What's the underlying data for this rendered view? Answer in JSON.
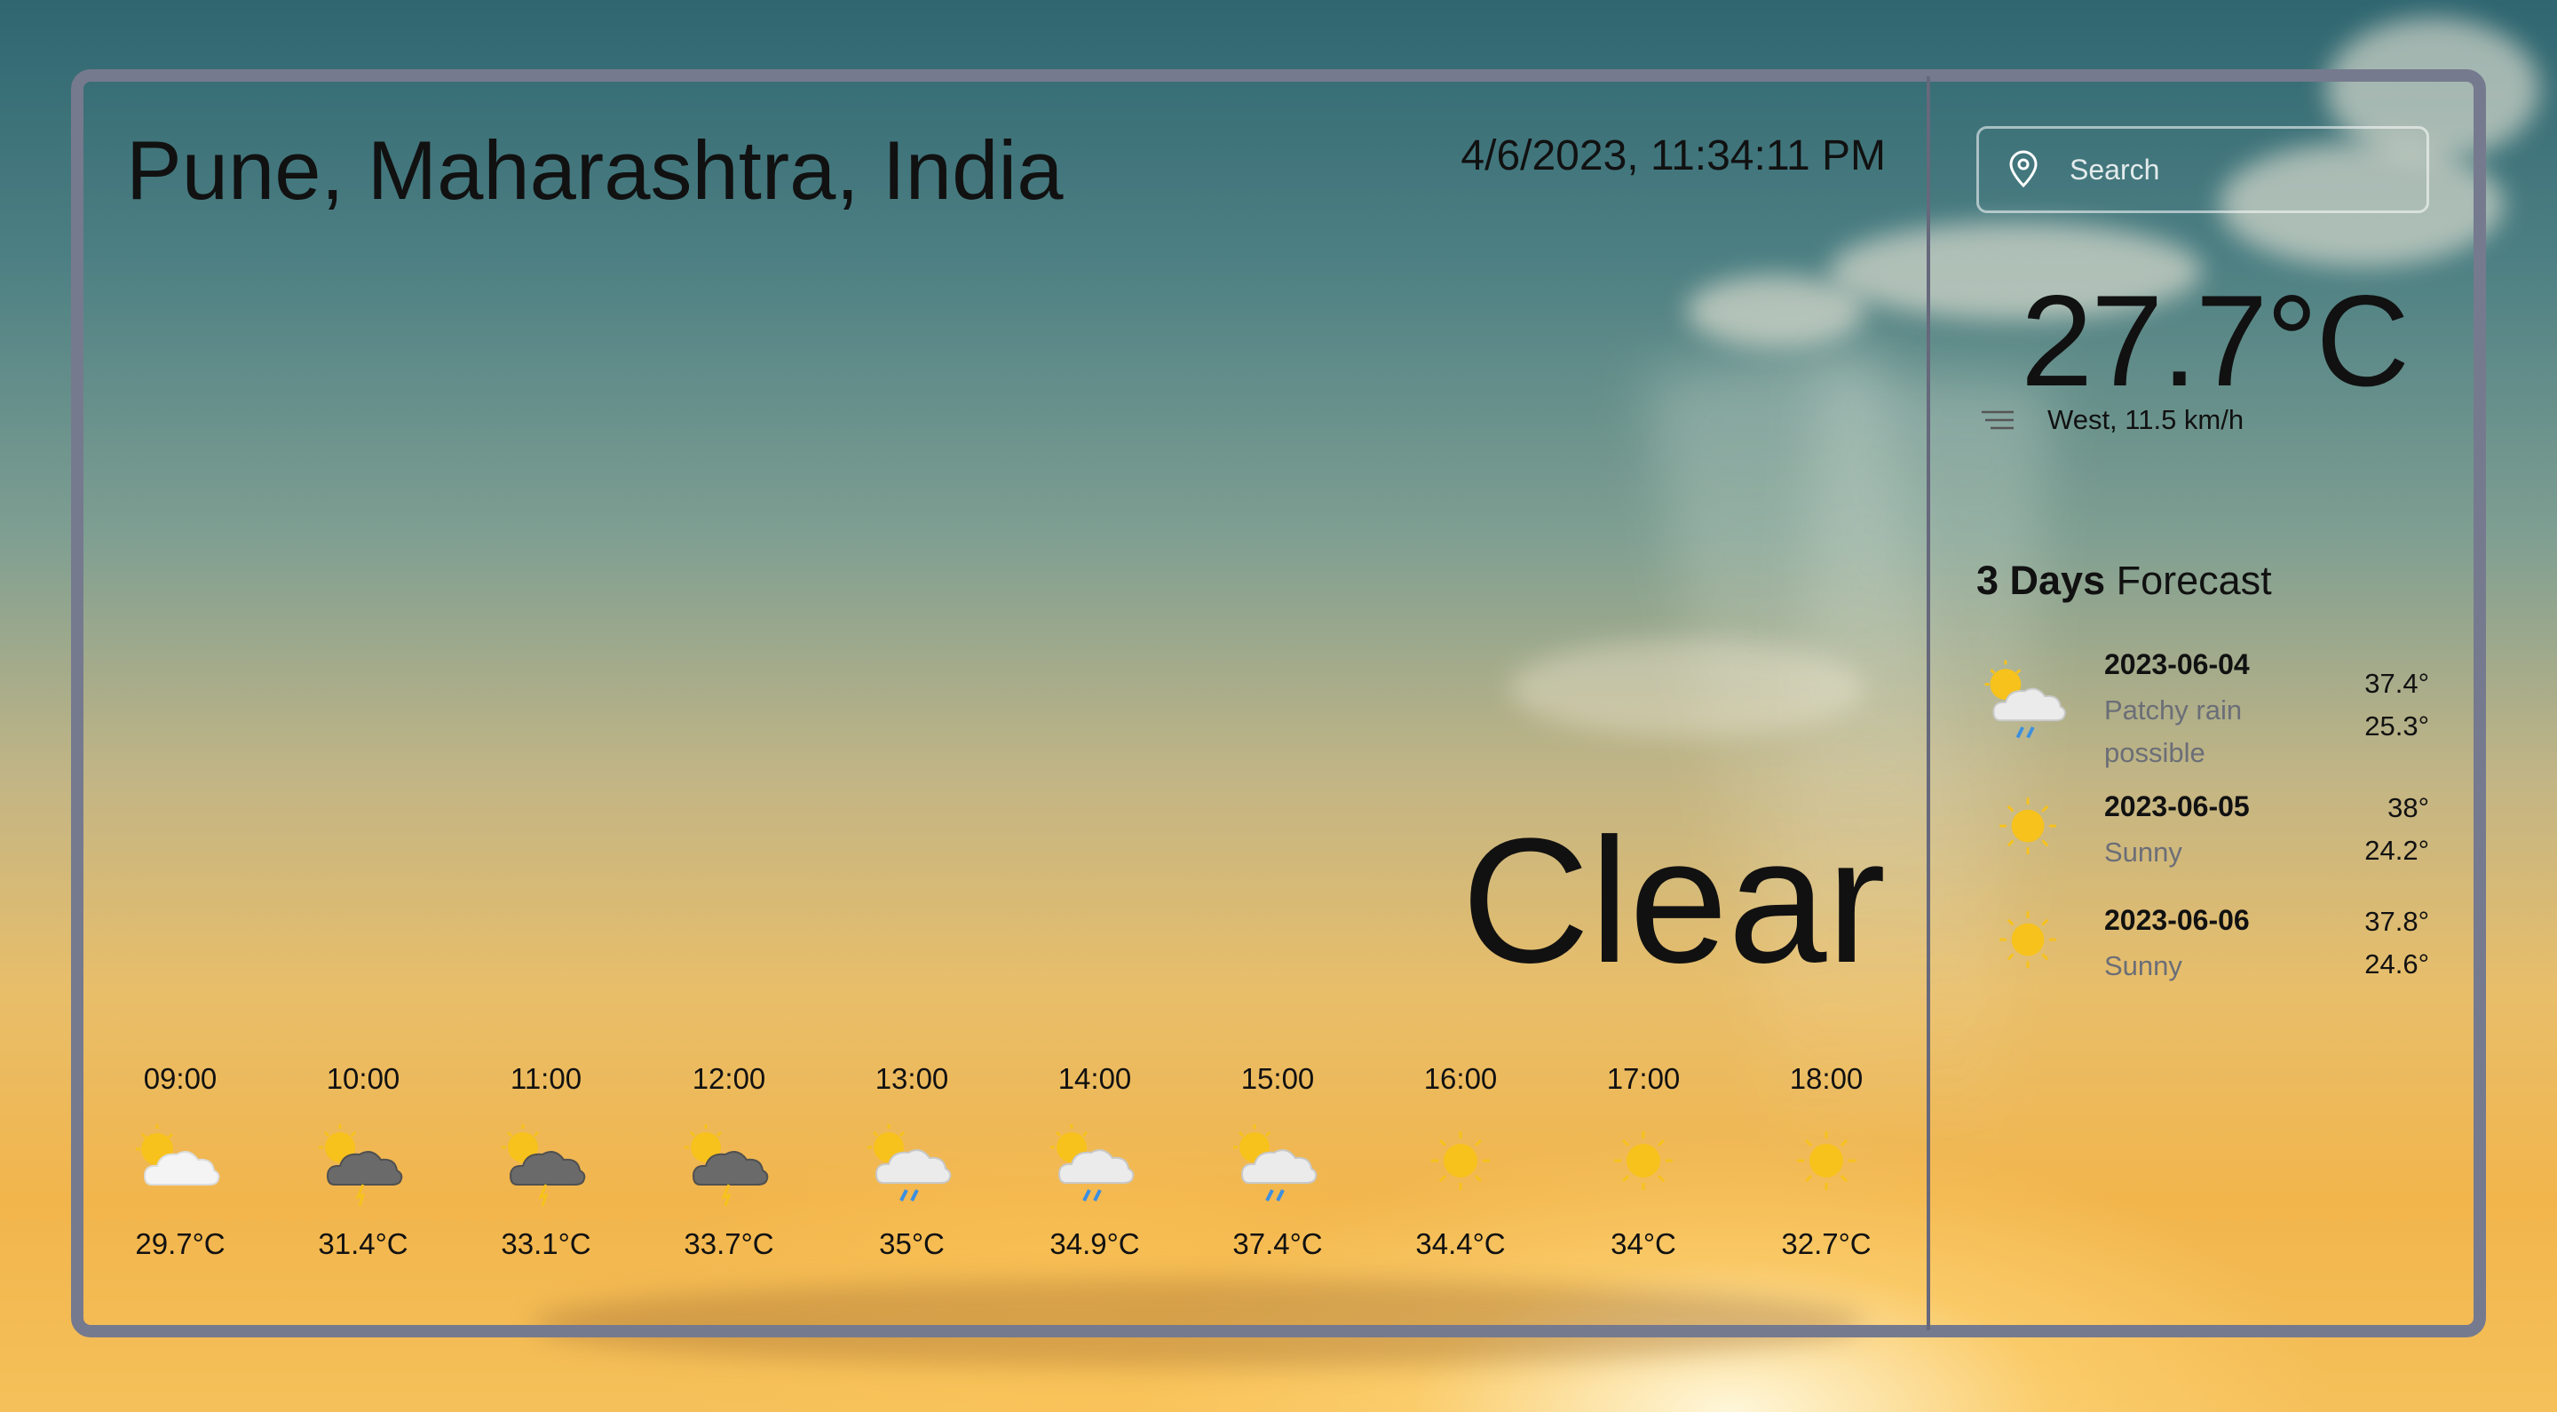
{
  "header": {
    "location": "Pune, Maharashtra, India",
    "datetime": "4/6/2023, 11:34:11 PM"
  },
  "current": {
    "condition": "Clear",
    "temperature": "27.7°C",
    "wind": "West, 11.5 km/h"
  },
  "search": {
    "placeholder": "Search",
    "value": ""
  },
  "hourly": [
    {
      "time": "09:00",
      "icon": "partly-cloudy-icon",
      "temp": "29.7°C"
    },
    {
      "time": "10:00",
      "icon": "thundery-outbreaks-icon",
      "temp": "31.4°C"
    },
    {
      "time": "11:00",
      "icon": "thundery-outbreaks-icon",
      "temp": "33.1°C"
    },
    {
      "time": "12:00",
      "icon": "thundery-outbreaks-icon",
      "temp": "33.7°C"
    },
    {
      "time": "13:00",
      "icon": "patchy-rain-icon",
      "temp": "35°C"
    },
    {
      "time": "14:00",
      "icon": "patchy-rain-icon",
      "temp": "34.9°C"
    },
    {
      "time": "15:00",
      "icon": "patchy-rain-icon",
      "temp": "37.4°C"
    },
    {
      "time": "16:00",
      "icon": "sunny-icon",
      "temp": "34.4°C"
    },
    {
      "time": "17:00",
      "icon": "sunny-icon",
      "temp": "34°C"
    },
    {
      "time": "18:00",
      "icon": "sunny-icon",
      "temp": "32.7°C"
    }
  ],
  "forecast": {
    "title_bold": "3 Days",
    "title_rest": " Forecast",
    "days": [
      {
        "date": "2023-06-04",
        "desc": "Patchy rain possible",
        "max": "37.4°",
        "min": "25.3°",
        "icon": "patchy-rain-icon"
      },
      {
        "date": "2023-06-05",
        "desc": "Sunny",
        "max": "38°",
        "min": "24.2°",
        "icon": "sunny-icon"
      },
      {
        "date": "2023-06-06",
        "desc": "Sunny",
        "max": "37.8°",
        "min": "24.6°",
        "icon": "sunny-icon"
      }
    ]
  },
  "colors": {
    "frame": "#767a8e",
    "divider": "#66687c",
    "text": "#111111",
    "muted": "#6b6e77",
    "sun": "#f7c21b",
    "rain": "#3c8fe0"
  }
}
